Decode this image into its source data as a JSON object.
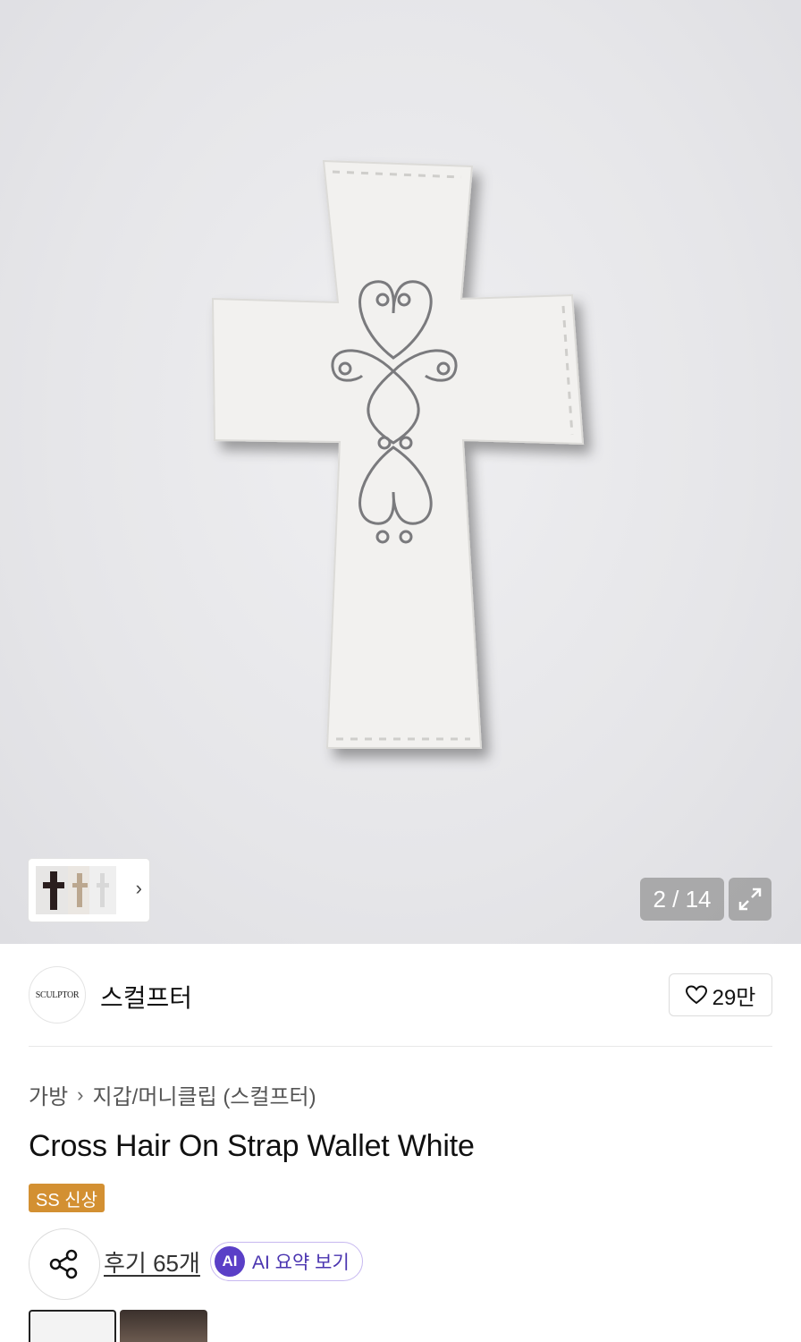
{
  "gallery": {
    "counter": "2 / 14",
    "expand_icon": "expand-icon",
    "thumb_chevron": "›"
  },
  "brand": {
    "logo_text": "SCULPTOR",
    "name": "스컬프터",
    "like_count": "29만"
  },
  "breadcrumb": [
    "가방",
    "지갑/머니클립 (스컬프터)"
  ],
  "product": {
    "title": "Cross Hair On Strap Wallet White",
    "badge": "SS 신상"
  },
  "actions": {
    "reviews": "후기 65개",
    "ai_badge": "AI",
    "ai_label": "AI 요약 보기"
  },
  "colors": {
    "badge": "#d39032",
    "ai_accent": "#5a3fc7"
  }
}
